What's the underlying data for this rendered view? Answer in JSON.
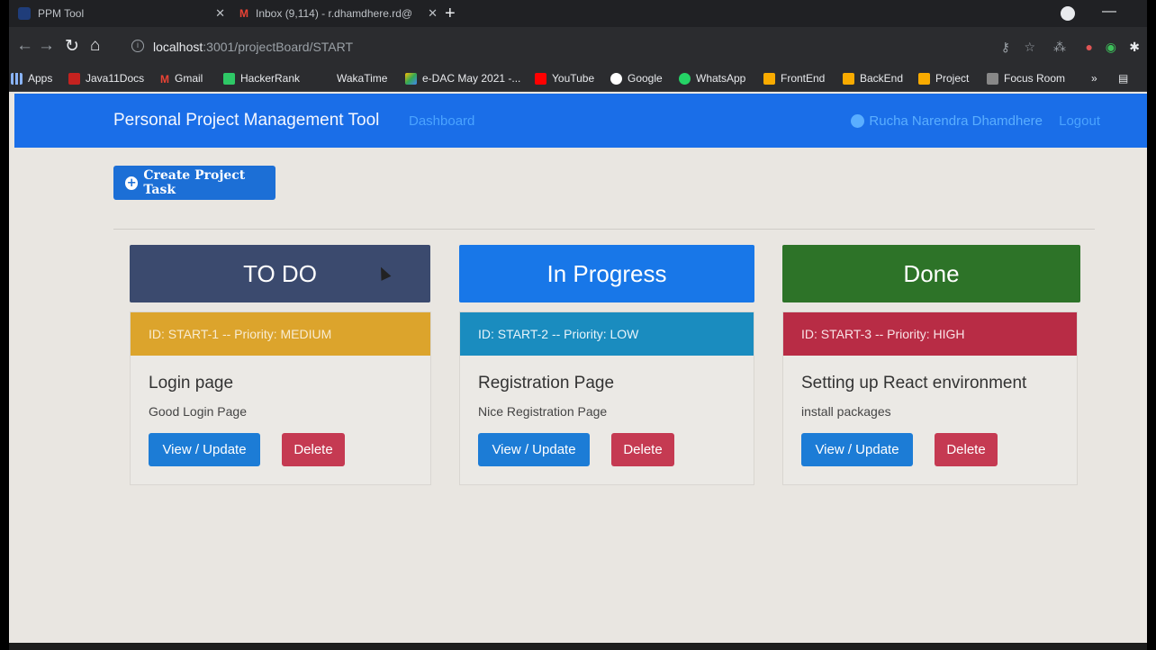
{
  "browser": {
    "tabs": [
      {
        "title": "PPM Tool"
      },
      {
        "title": "Inbox (9,114) - r.dhamdhere.rd@"
      }
    ],
    "url_host": "localhost",
    "url_rest": ":3001/projectBoard/START",
    "bookmarks": [
      {
        "label": "Apps",
        "icon": "apps-grid-icon"
      },
      {
        "label": "Java11Docs",
        "icon": "oracle-icon"
      },
      {
        "label": "Gmail",
        "icon": "gmail-icon"
      },
      {
        "label": "HackerRank",
        "icon": "hackerrank-icon"
      },
      {
        "label": "WakaTime",
        "icon": "wakatime-icon"
      },
      {
        "label": "e-DAC May 2021 -...",
        "icon": "drive-icon"
      },
      {
        "label": "YouTube",
        "icon": "youtube-icon"
      },
      {
        "label": "Google",
        "icon": "google-icon"
      },
      {
        "label": "WhatsApp",
        "icon": "whatsapp-icon"
      },
      {
        "label": "FrontEnd",
        "icon": "folder-icon"
      },
      {
        "label": "BackEnd",
        "icon": "folder-icon"
      },
      {
        "label": "Project",
        "icon": "folder-icon"
      },
      {
        "label": "Focus Room",
        "icon": "focus-icon"
      }
    ]
  },
  "navbar": {
    "brand": "Personal Project Management Tool",
    "dashboard": "Dashboard",
    "user": "Rucha Narendra Dhamdhere",
    "logout": "Logout"
  },
  "actions": {
    "create_label": "Create Project Task"
  },
  "columns": [
    {
      "title": "TO DO",
      "color": "#3b4a6e"
    },
    {
      "title": "In Progress",
      "color": "#1877e8"
    },
    {
      "title": "Done",
      "color": "#2d7328"
    }
  ],
  "tasks": [
    {
      "header": "ID: START-1 -- Priority: MEDIUM",
      "title": "Login page",
      "desc": "Good Login Page",
      "view": "View / Update",
      "delete": "Delete",
      "priority_color": "#dca42c"
    },
    {
      "header": "ID: START-2 -- Priority: LOW",
      "title": "Registration Page",
      "desc": "Nice Registration Page",
      "view": "View / Update",
      "delete": "Delete",
      "priority_color": "#1a8cbf"
    },
    {
      "header": "ID: START-3 -- Priority: HIGH",
      "title": "Setting up React environment",
      "desc": "install packages",
      "view": "View / Update",
      "delete": "Delete",
      "priority_color": "#b82c45"
    }
  ]
}
